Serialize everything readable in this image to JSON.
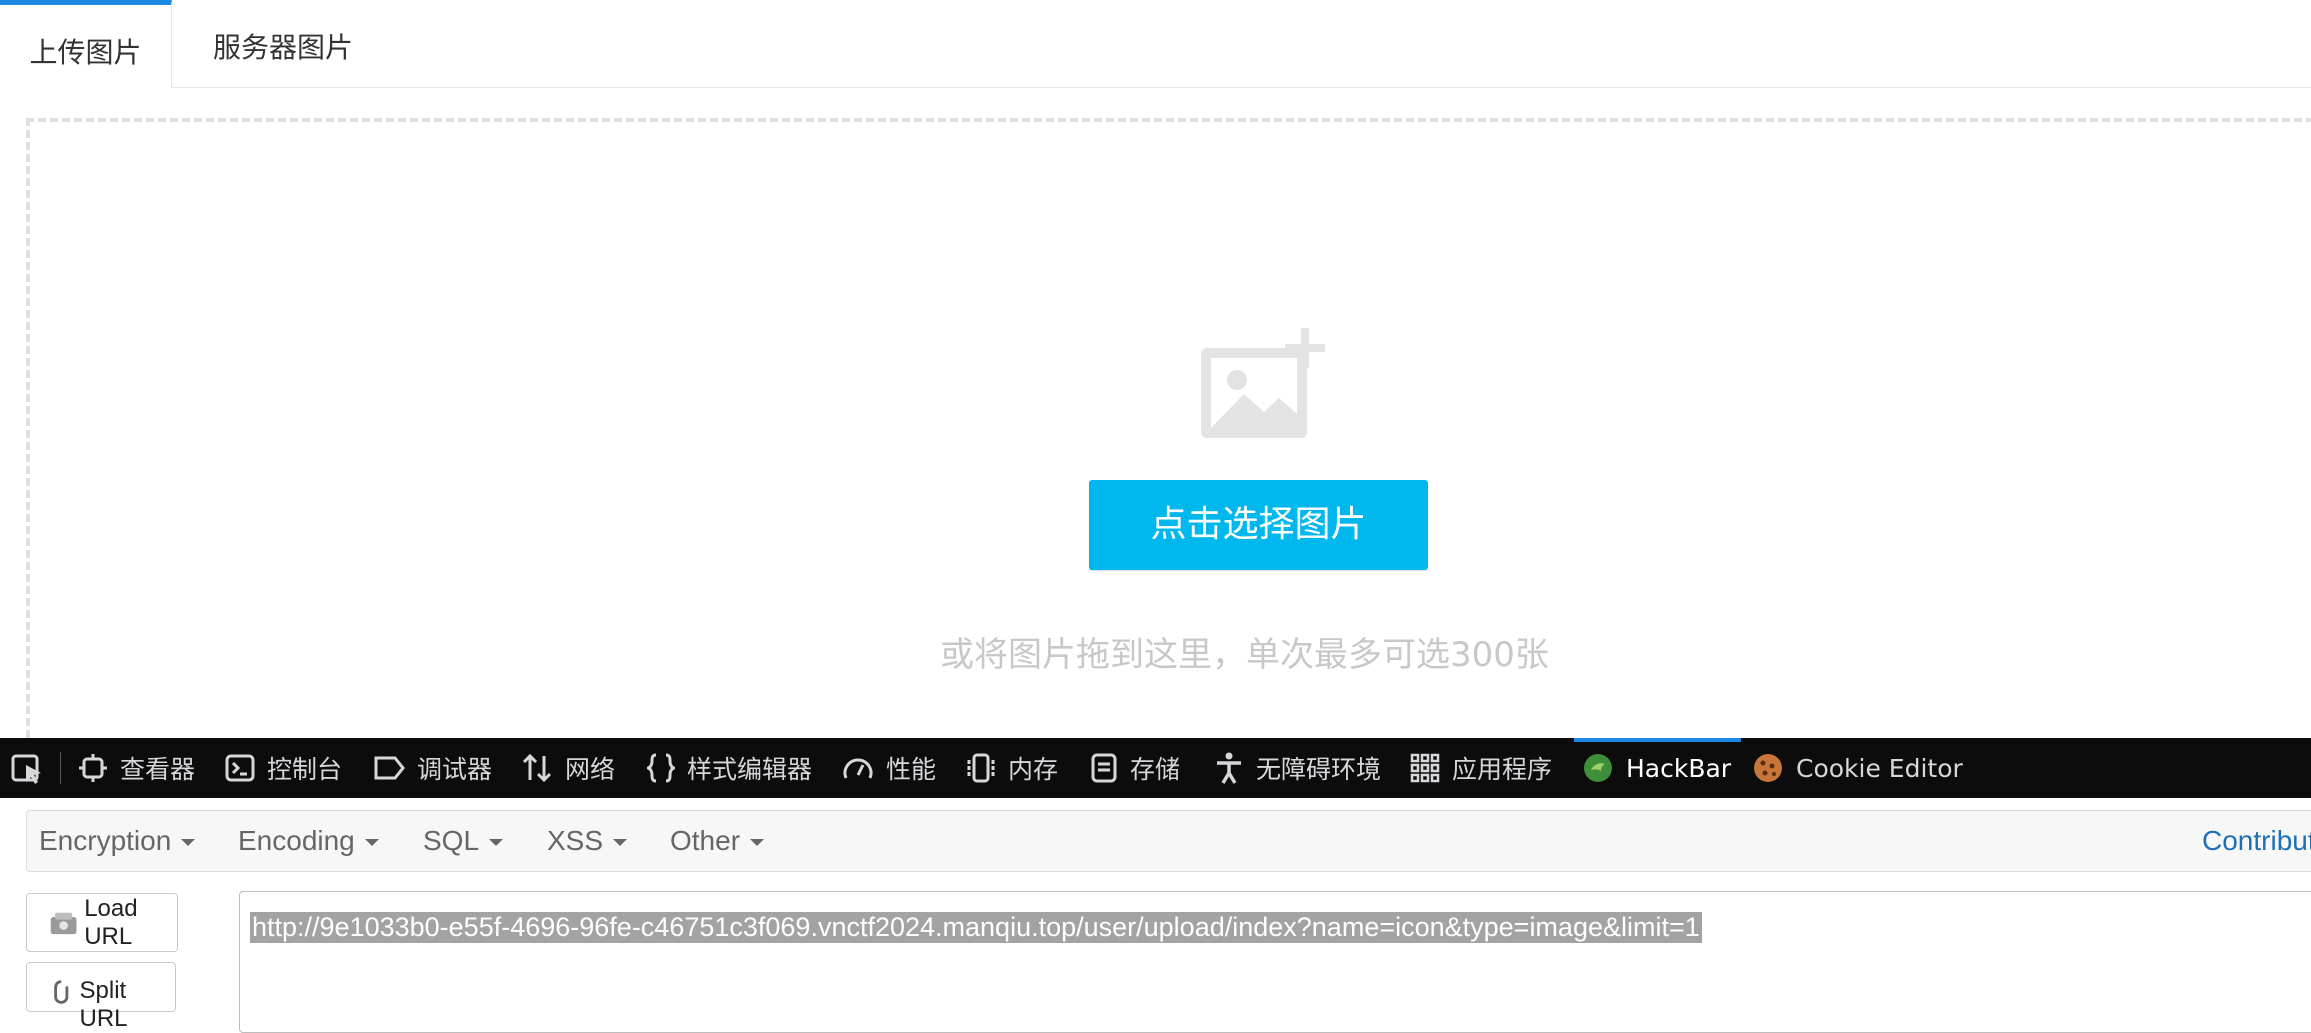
{
  "tabs": {
    "upload": "上传图片",
    "server": "服务器图片"
  },
  "upload": {
    "icon": "image-add-icon",
    "button_label": "点击选择图片",
    "hint": "或将图片拖到这里，单次最多可选300张"
  },
  "devtools": {
    "items": [
      {
        "label": "查看器",
        "icon": "inspector-icon"
      },
      {
        "label": "控制台",
        "icon": "console-icon"
      },
      {
        "label": "调试器",
        "icon": "debugger-icon"
      },
      {
        "label": "网络",
        "icon": "network-icon"
      },
      {
        "label": "样式编辑器",
        "icon": "style-editor-icon"
      },
      {
        "label": "性能",
        "icon": "performance-icon"
      },
      {
        "label": "内存",
        "icon": "memory-icon"
      },
      {
        "label": "存储",
        "icon": "storage-icon"
      },
      {
        "label": "无障碍环境",
        "icon": "accessibility-icon"
      },
      {
        "label": "应用程序",
        "icon": "application-icon"
      },
      {
        "label": "HackBar",
        "icon": "hackbar-icon"
      },
      {
        "label": "Cookie Editor",
        "icon": "cookie-icon"
      }
    ],
    "active": "HackBar"
  },
  "hackbar": {
    "menu": [
      "Encryption",
      "Encoding",
      "SQL",
      "XSS",
      "Other"
    ],
    "contribute": "Contribute",
    "load_url": "Load URL",
    "split_url": "Split URL",
    "url": "http://9e1033b0-e55f-4696-96fe-c46751c3f069.vnctf2024.manqiu.top/user/upload/index?name=icon&type=image&limit=1"
  },
  "colors": {
    "accent": "#1e88e5",
    "pick_button": "#00b7ee",
    "devtools_bg": "#0c0c0d"
  }
}
